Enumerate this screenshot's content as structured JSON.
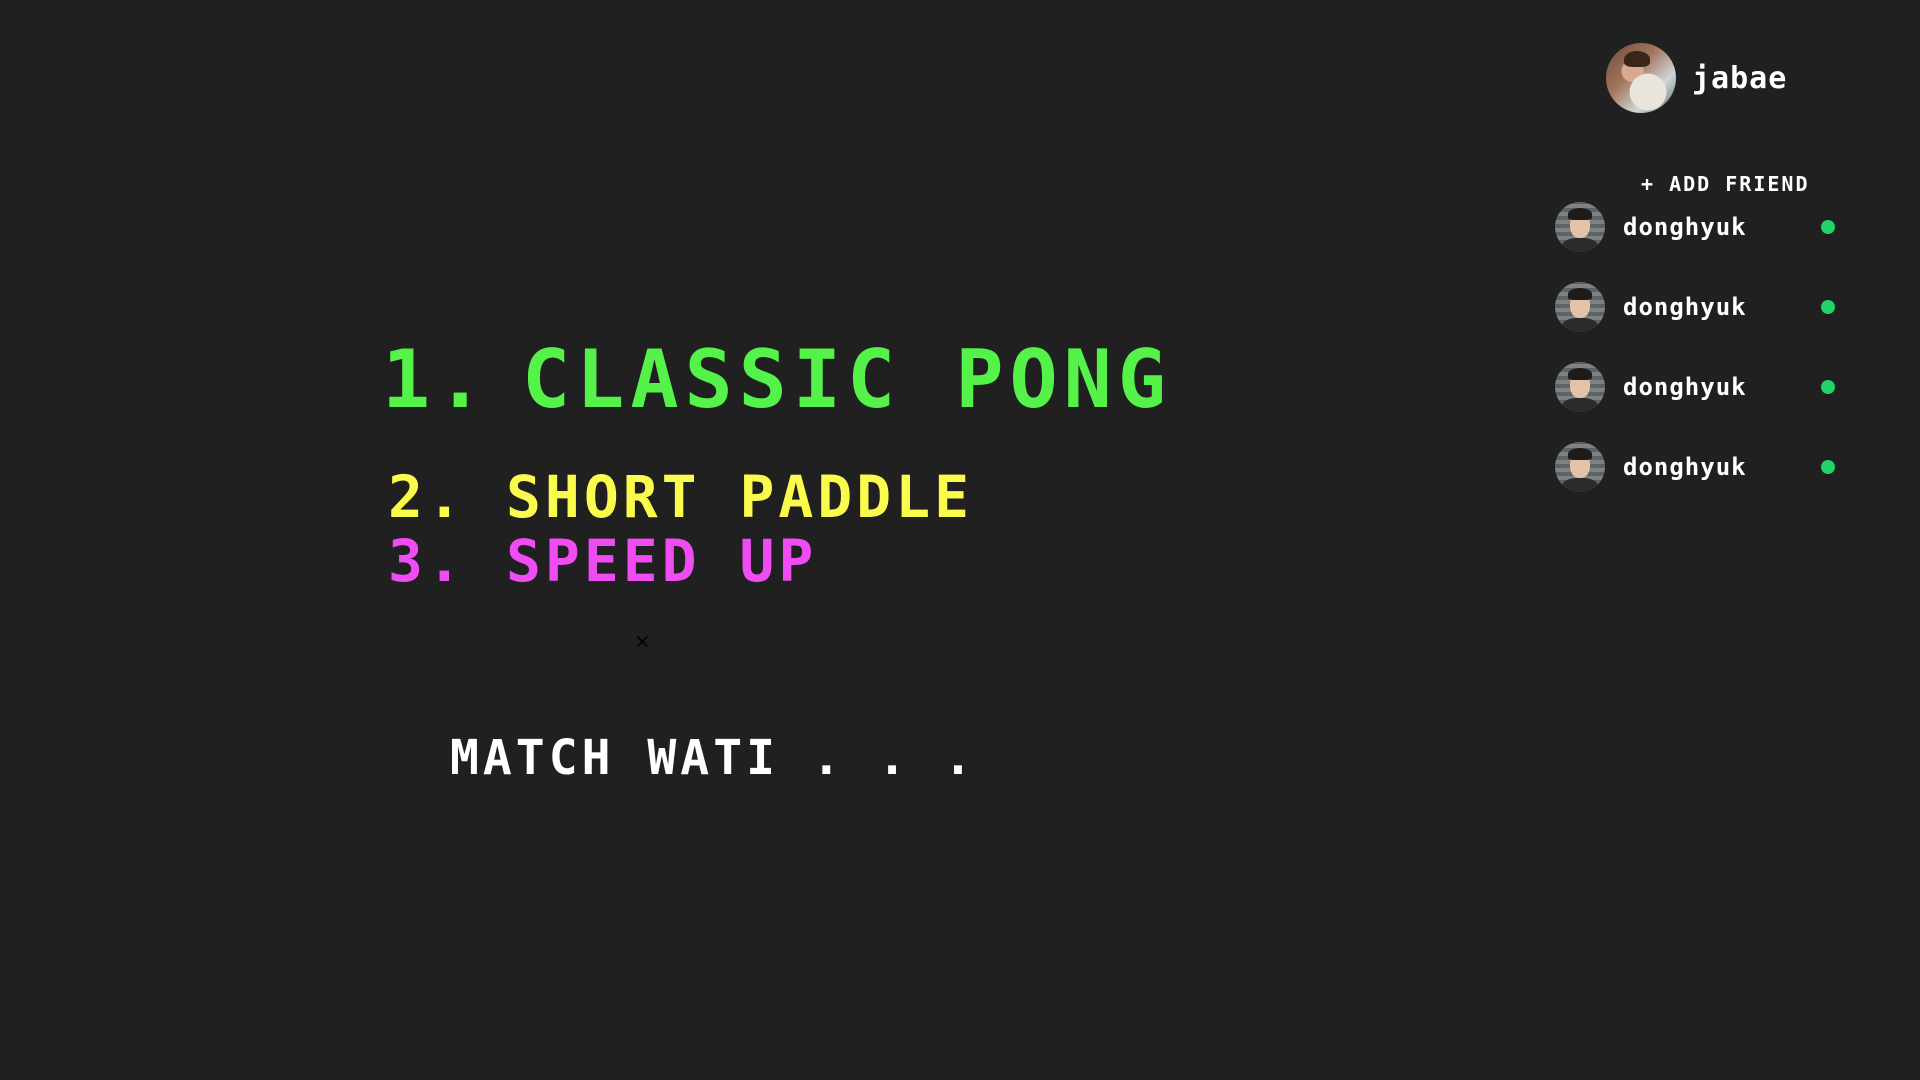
{
  "modes": [
    {
      "number": "1.",
      "label": "CLASSIC PONG",
      "color": "#55f34a"
    },
    {
      "number": "2.",
      "label": "SHORT PADDLE",
      "color": "#fbfb4d"
    },
    {
      "number": "3.",
      "label": "SPEED UP",
      "color": "#f04cf3"
    }
  ],
  "close_icon": {
    "glyph": "×",
    "icon": "close-icon"
  },
  "status_text": "MATCH WATI . . .",
  "profile": {
    "name": "jabae",
    "avatar_icon": "user-avatar"
  },
  "friends_panel": {
    "add_friend_label": "+ ADD FRIEND",
    "friends": [
      {
        "name": "donghyuk",
        "status": "online",
        "status_color": "#22d36b"
      },
      {
        "name": "donghyuk",
        "status": "online",
        "status_color": "#22d36b"
      },
      {
        "name": "donghyuk",
        "status": "online",
        "status_color": "#22d36b"
      },
      {
        "name": "donghyuk",
        "status": "online",
        "status_color": "#22d36b"
      }
    ]
  },
  "colors": {
    "background": "#202020",
    "text": "#ffffff"
  }
}
